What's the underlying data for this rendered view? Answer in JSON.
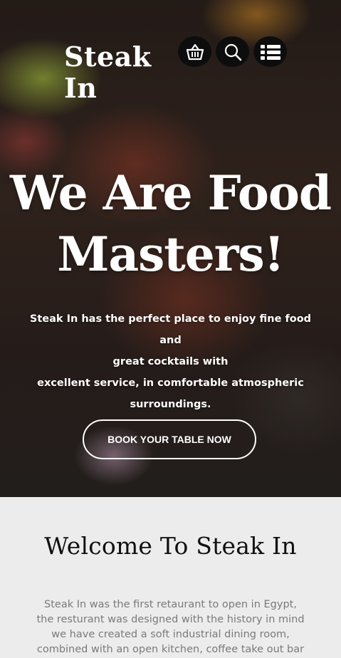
{
  "brand": {
    "logo_line1": "Steak",
    "logo_line2": "In"
  },
  "header": {
    "icons": [
      "basket-icon",
      "search-icon",
      "menu-icon"
    ]
  },
  "hero": {
    "headline_line1": "We Are Food",
    "headline_line2": "Masters!",
    "intro_lines": [
      "Steak In has the perfect place to enjoy fine food and",
      "great cocktails with",
      "excellent service, in comfortable atmospheric",
      "surroundings."
    ],
    "cta_label": "BOOK YOUR TABLE NOW"
  },
  "welcome": {
    "title": "Welcome To Steak In",
    "text_lines": [
      "Steak In was the first retaurant to open in Egypt,",
      "the resturant was designed with the history in mind",
      "we have created a soft industrial dining room,",
      "combined with an open kitchen, coffee take out bar"
    ]
  },
  "colors": {
    "icon_bg": "#0d0d0d",
    "hero_text": "#ffffff",
    "welcome_bg": "#ececec",
    "welcome_title": "#111111",
    "welcome_text": "#7a7a7a"
  }
}
